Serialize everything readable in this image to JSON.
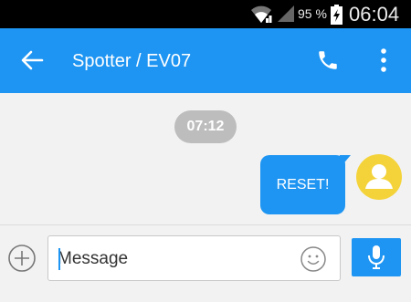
{
  "status_bar": {
    "battery_percent": "95 %",
    "time": "06:04",
    "icons": [
      "wifi-icon",
      "signal-icon",
      "battery-charging-icon"
    ]
  },
  "app_bar": {
    "title": "Spotter / EV07",
    "icons": [
      "back-arrow-icon",
      "phone-icon",
      "overflow-menu-icon"
    ],
    "color": "#1e95f2"
  },
  "conversation": {
    "timestamp": "07:12",
    "messages": [
      {
        "text": "RESET!",
        "direction": "outgoing"
      }
    ],
    "avatar_color": "#f4d33a"
  },
  "composer": {
    "placeholder": "Message",
    "icons": [
      "add-circle-icon",
      "emoji-icon",
      "microphone-icon"
    ]
  }
}
